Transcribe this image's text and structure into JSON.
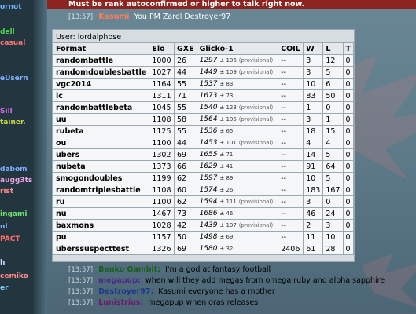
{
  "sidebar": {
    "users": [
      {
        "name": "ornot",
        "color": "#6fb3ff"
      },
      {
        "name": "dell",
        "color": "#4fd14f"
      },
      {
        "name": "casual",
        "color": "#ff7878"
      },
      {
        "name": "eUsern",
        "color": "#7fb0ff"
      },
      {
        "name": "Sill",
        "color": "#c96fe0"
      },
      {
        "name": "tainer.",
        "color": "#c7d94a"
      },
      {
        "name": "dabom",
        "color": "#7fb0ff"
      },
      {
        "name": "augg3ts",
        "color": "#e8a4e8"
      },
      {
        "name": "rist",
        "color": "#ff8a8a"
      },
      {
        "name": "ingami",
        "color": "#6fe06f"
      },
      {
        "name": "nl",
        "color": "#7fb0ff"
      },
      {
        "name": "PACT",
        "color": "#ff6f6f"
      },
      {
        "name": "h",
        "color": "#d7d7ff"
      },
      {
        "name": "cemiko",
        "color": "#ff8a8a"
      },
      {
        "name": "er",
        "color": "#7fd0ff"
      }
    ]
  },
  "warning": {
    "text": "Must be rank autoconfirmed or higher to talk right now."
  },
  "pm_header": {
    "timestamp": "[13:57]",
    "sender": "Kasumi",
    "text": "You PM Zarel Destroyer97"
  },
  "user_card": {
    "user_label": "User: lordalphose",
    "headers": [
      "Format",
      "Elo",
      "GXE",
      "Glicko-1",
      "COIL",
      "W",
      "L",
      "T"
    ],
    "rows": [
      {
        "format": "randombattle",
        "elo": "1000",
        "gxe": "26",
        "glicko": "1297",
        "dev": "± 106",
        "provisional": "(provisional)",
        "coil": "--",
        "w": "3",
        "l": "12",
        "t": "0"
      },
      {
        "format": "randomdoublesbattle",
        "elo": "1027",
        "gxe": "44",
        "glicko": "1449",
        "dev": "± 109",
        "provisional": "(provisional)",
        "coil": "--",
        "w": "3",
        "l": "5",
        "t": "0"
      },
      {
        "format": "vgc2014",
        "elo": "1164",
        "gxe": "55",
        "glicko": "1537",
        "dev": "± 83",
        "provisional": "",
        "coil": "--",
        "w": "10",
        "l": "6",
        "t": "0"
      },
      {
        "format": "lc",
        "elo": "1311",
        "gxe": "71",
        "glicko": "1673",
        "dev": "± 73",
        "provisional": "",
        "coil": "--",
        "w": "83",
        "l": "50",
        "t": "0"
      },
      {
        "format": "randombattlebeta",
        "elo": "1045",
        "gxe": "55",
        "glicko": "1540",
        "dev": "± 123",
        "provisional": "(provisional)",
        "coil": "--",
        "w": "1",
        "l": "0",
        "t": "0"
      },
      {
        "format": "uu",
        "elo": "1108",
        "gxe": "58",
        "glicko": "1564",
        "dev": "± 105",
        "provisional": "(provisional)",
        "coil": "--",
        "w": "3",
        "l": "1",
        "t": "0"
      },
      {
        "format": "rubeta",
        "elo": "1125",
        "gxe": "55",
        "glicko": "1536",
        "dev": "± 65",
        "provisional": "",
        "coil": "--",
        "w": "18",
        "l": "15",
        "t": "0"
      },
      {
        "format": "ou",
        "elo": "1100",
        "gxe": "44",
        "glicko": "1453",
        "dev": "± 101",
        "provisional": "(provisional)",
        "coil": "--",
        "w": "4",
        "l": "4",
        "t": "0"
      },
      {
        "format": "ubers",
        "elo": "1302",
        "gxe": "69",
        "glicko": "1655",
        "dev": "± 71",
        "provisional": "",
        "coil": "--",
        "w": "14",
        "l": "5",
        "t": "0"
      },
      {
        "format": "nubeta",
        "elo": "1373",
        "gxe": "66",
        "glicko": "1629",
        "dev": "± 41",
        "provisional": "",
        "coil": "--",
        "w": "91",
        "l": "64",
        "t": "0"
      },
      {
        "format": "smogondoubles",
        "elo": "1199",
        "gxe": "62",
        "glicko": "1597",
        "dev": "± 89",
        "provisional": "",
        "coil": "--",
        "w": "10",
        "l": "5",
        "t": "0"
      },
      {
        "format": "randomtriplesbattle",
        "elo": "1108",
        "gxe": "60",
        "glicko": "1574",
        "dev": "± 26",
        "provisional": "",
        "coil": "--",
        "w": "183",
        "l": "167",
        "t": "0"
      },
      {
        "format": "ru",
        "elo": "1100",
        "gxe": "62",
        "glicko": "1594",
        "dev": "± 111",
        "provisional": "(provisional)",
        "coil": "--",
        "w": "3",
        "l": "0",
        "t": "0"
      },
      {
        "format": "nu",
        "elo": "1467",
        "gxe": "73",
        "glicko": "1686",
        "dev": "± 46",
        "provisional": "",
        "coil": "--",
        "w": "46",
        "l": "24",
        "t": "0"
      },
      {
        "format": "baxmons",
        "elo": "1028",
        "gxe": "42",
        "glicko": "1439",
        "dev": "± 107",
        "provisional": "(provisional)",
        "coil": "--",
        "w": "2",
        "l": "3",
        "t": "0"
      },
      {
        "format": "pu",
        "elo": "1157",
        "gxe": "50",
        "glicko": "1498",
        "dev": "± 69",
        "provisional": "",
        "coil": "--",
        "w": "11",
        "l": "10",
        "t": "0"
      },
      {
        "format": "uberssuspecttest",
        "elo": "1326",
        "gxe": "69",
        "glicko": "1580",
        "dev": "± 32",
        "provisional": "",
        "coil": "2406",
        "w": "61",
        "l": "28",
        "t": "0"
      }
    ]
  },
  "chat": [
    {
      "timestamp": "[13:57]",
      "user": "Benko Gambit:",
      "color": "#1a5e1a",
      "message": "I'm a god at fantasy football"
    },
    {
      "timestamp": "[13:57]",
      "user": "megapup:",
      "color": "#4a2a8a",
      "message": "when will they add megas from omega ruby and alpha sapphire"
    },
    {
      "timestamp": "[13:57]",
      "user": "Destroyer97:",
      "color": "#1a3a8a",
      "message": "Kasumi everyone has a mother"
    },
    {
      "timestamp": "[13:57]",
      "user": "Lunistrius:",
      "color": "#6a1a6a",
      "message": "megapup when oras releases"
    }
  ]
}
